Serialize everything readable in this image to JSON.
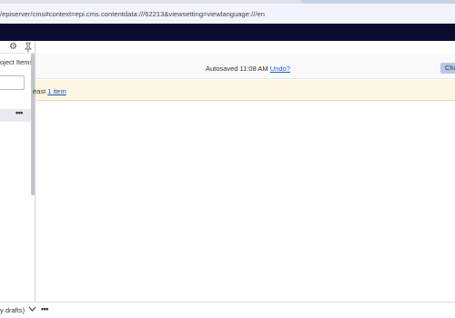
{
  "browser": {
    "url": "/episerver/cms#context=epi.cms.contentdata:///62213&viewsetting=viewlanguage:///en"
  },
  "left_panel": {
    "title": "oject Items",
    "settings_icon": "gear-icon",
    "pin_icon": "pin-icon",
    "search_placeholder": "",
    "row_menu_label": "•••"
  },
  "toolbar": {
    "autosave_text": "Autosaved 11:08 AM",
    "undo_label": "Undo?",
    "change_button_label": "Change"
  },
  "notice": {
    "text_prefix": "east",
    "link_label": "1 item"
  },
  "bottom_bar": {
    "filter_label": "y drafts)",
    "menu_label": "•••"
  },
  "colors": {
    "nav_bar": "#0b0b2f",
    "notice_bg": "#fdf6e2",
    "link": "#1a5ad7",
    "button_bg": "#b8c8e8"
  }
}
